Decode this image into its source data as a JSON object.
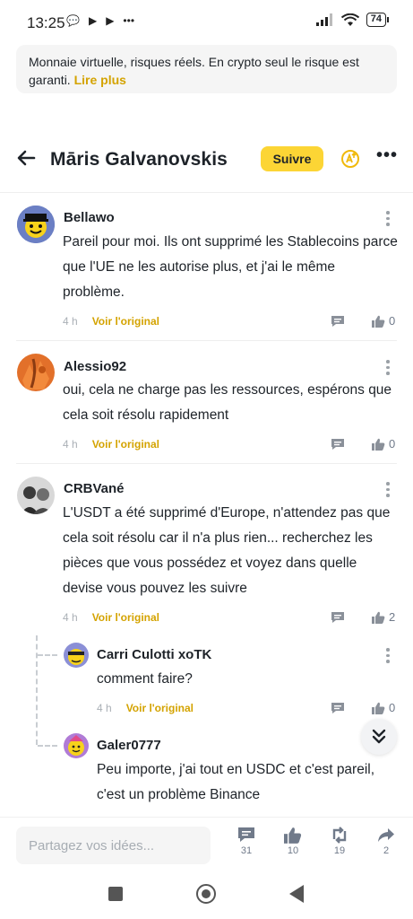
{
  "status_bar": {
    "time": "13:25",
    "battery": "74"
  },
  "banner": {
    "text": "Monnaie virtuelle, risques réels. En crypto seul le risque est garanti. ",
    "link": "Lire plus"
  },
  "header": {
    "title": "Māris Galvanovskis",
    "follow_label": "Suivre"
  },
  "comments": [
    {
      "author": "Bellawo",
      "text": "Pareil pour moi. Ils ont supprimé les Stablecoins parce que l'UE ne les autorise plus, et j'ai le même problème.",
      "time": "4 h",
      "original": "Voir l'original",
      "likes": "0"
    },
    {
      "author": "Alessio92",
      "text": "oui, cela ne charge pas les ressources, espérons que cela soit résolu rapidement",
      "time": "4 h",
      "original": "Voir l'original",
      "likes": "0"
    },
    {
      "author": "CRBVané",
      "text": "L'USDT a été supprimé d'Europe, n'attendez pas que cela soit résolu car il n'a plus rien... recherchez les pièces que vous possédez et voyez dans quelle devise vous pouvez les suivre",
      "time": "4 h",
      "original": "Voir l'original",
      "likes": "2"
    }
  ],
  "replies": [
    {
      "author": "Carri Culotti xoTK",
      "text": "comment faire?",
      "time": "4 h",
      "original": "Voir l'original",
      "likes": "0"
    },
    {
      "author": "Galer0777",
      "text": "Peu importe, j'ai tout en USDC et c'est pareil, c'est un problème Binance"
    }
  ],
  "bottom_bar": {
    "placeholder": "Partagez vos idées...",
    "comments_count": "31",
    "likes_count": "10",
    "reposts_count": "19",
    "shares_count": "2"
  },
  "colors": {
    "accent": "#fcd535",
    "link": "#d4a300",
    "muted": "#aab0b6"
  }
}
